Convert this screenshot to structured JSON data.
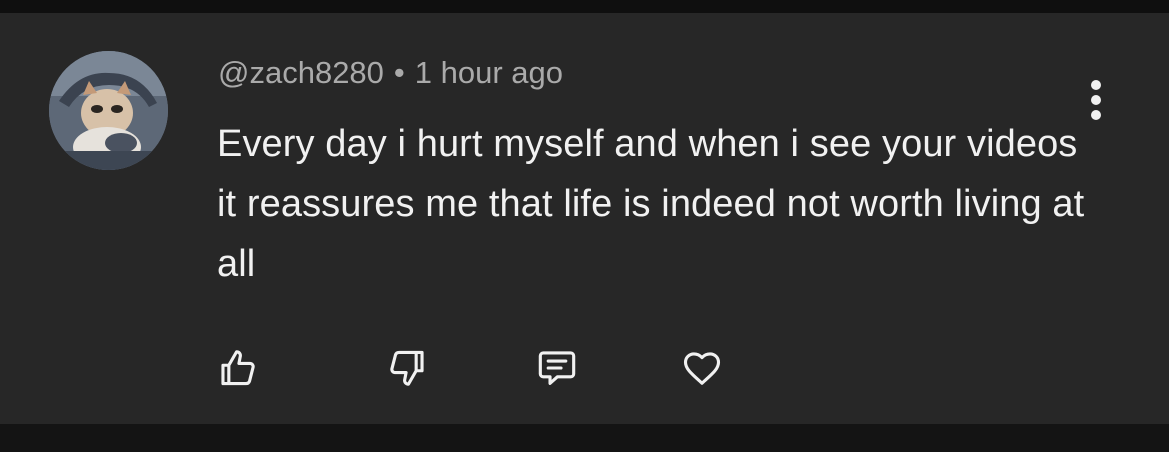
{
  "comment": {
    "author": "@zach8280",
    "separator": "•",
    "timestamp": "1 hour ago",
    "text": "Every day i hurt myself and when i see your videos it reassures me that life is indeed not worth living at all"
  },
  "icons": {
    "avatar": "avatar-image",
    "more": "more-vertical-icon",
    "like": "thumbs-up-icon",
    "dislike": "thumbs-down-icon",
    "reply": "reply-comment-icon",
    "heart": "heart-icon"
  },
  "colors": {
    "card_background": "#272727",
    "page_background": "#111111",
    "primary_text": "#f1f1f1",
    "secondary_text": "#aaaaaa"
  }
}
